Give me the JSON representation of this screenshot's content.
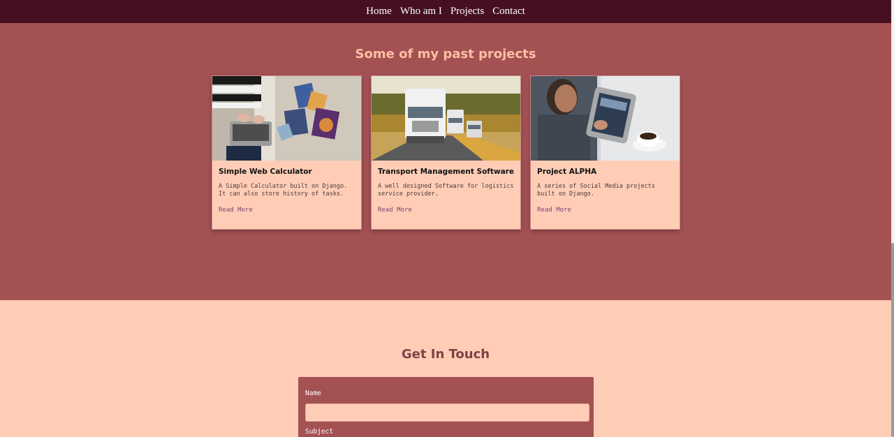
{
  "nav": {
    "items": [
      {
        "label": "Home"
      },
      {
        "label": "Who am I"
      },
      {
        "label": "Projects"
      },
      {
        "label": "Contact"
      }
    ]
  },
  "projects": {
    "heading": "Some of my past projects",
    "cards": [
      {
        "title": "Simple Web Calculator",
        "description": "A Simple Calculator built on Django. It can also store history of tasks.",
        "link": "Read More",
        "image": "laptop-books-photo"
      },
      {
        "title": "Transport Management Software",
        "description": "A well designed Software for logistics service provider.",
        "link": "Read More",
        "image": "trucks-on-road-photo"
      },
      {
        "title": "Project ALPHA",
        "description": "A series of Social Media projects built on Django.",
        "link": "Read More",
        "image": "tablet-coffee-photo"
      }
    ]
  },
  "contact": {
    "heading": "Get In Touch",
    "fields": {
      "name_label": "Name",
      "subject_label": "Subject",
      "name_value": ""
    }
  },
  "colors": {
    "nav_bg": "#451020",
    "projects_bg": "#a45154",
    "page_bg": "#ffcdb6",
    "heading_light": "#ffbfa3",
    "heading_dark": "#7f4143"
  }
}
